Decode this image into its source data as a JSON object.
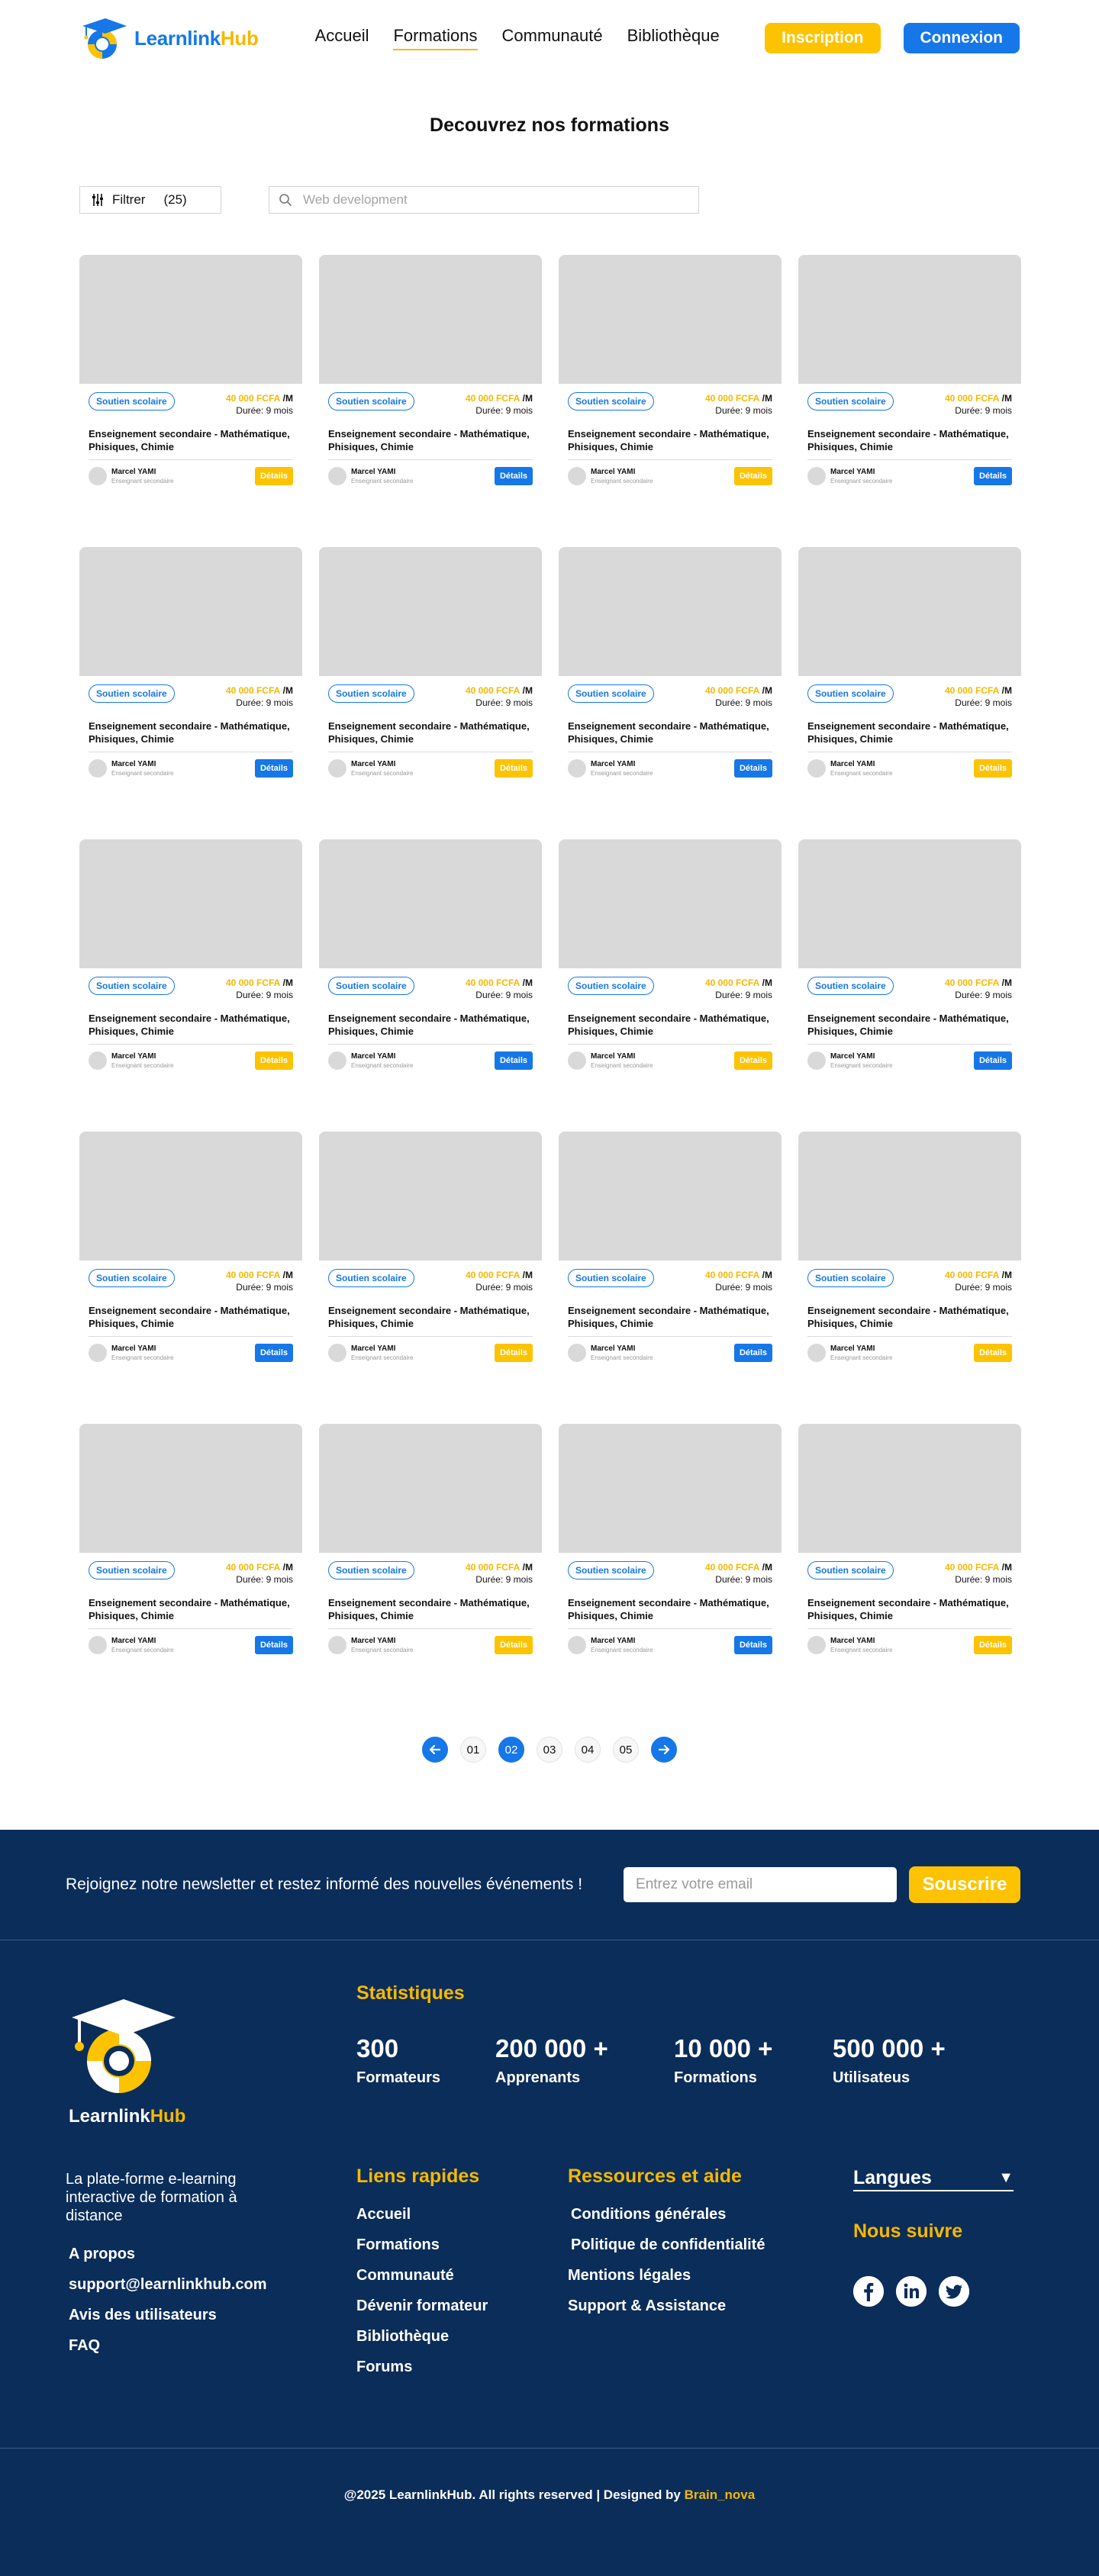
{
  "brand": {
    "name_part1": "Learnlink",
    "name_part2": "Hub"
  },
  "nav": {
    "items": [
      "Accueil",
      "Formations",
      "Communauté",
      "Bibliothèque"
    ],
    "active": "Formations"
  },
  "header": {
    "signup_label": "Inscription",
    "login_label": "Connexion"
  },
  "page": {
    "title": "Decouvrez nos formations"
  },
  "filter": {
    "label": "Filtrer",
    "count": "(25)"
  },
  "search": {
    "placeholder": "Web development"
  },
  "course_template": {
    "tag": "Soutien scolaire",
    "price": "40 000 FCFA",
    "per": "/M",
    "duration": "Durée: 9 mois",
    "title": "Enseignement secondaire - Mathématique, Phisiques, Chimie",
    "author": "Marcel YAMI",
    "author_role": "Enseignant secondaire",
    "details_label": "Détails"
  },
  "courses": [
    {
      "details_color": "yellow"
    },
    {
      "details_color": "blue"
    },
    {
      "details_color": "yellow"
    },
    {
      "details_color": "blue"
    },
    {
      "details_color": "blue"
    },
    {
      "details_color": "yellow"
    },
    {
      "details_color": "blue"
    },
    {
      "details_color": "yellow"
    },
    {
      "details_color": "yellow"
    },
    {
      "details_color": "blue"
    },
    {
      "details_color": "yellow"
    },
    {
      "details_color": "blue"
    },
    {
      "details_color": "blue"
    },
    {
      "details_color": "yellow"
    },
    {
      "details_color": "blue"
    },
    {
      "details_color": "yellow"
    },
    {
      "details_color": "blue"
    },
    {
      "details_color": "yellow"
    },
    {
      "details_color": "blue"
    },
    {
      "details_color": "yellow"
    }
  ],
  "pagination": {
    "pages": [
      "01",
      "02",
      "03",
      "04",
      "05"
    ],
    "current": "02"
  },
  "newsletter": {
    "text": "Rejoignez notre newsletter et restez informé des nouvelles événements !",
    "placeholder": "Entrez votre email",
    "button": "Souscrire"
  },
  "stats": {
    "title": "Statistiques",
    "items": [
      {
        "value": "300",
        "label": "Formateurs"
      },
      {
        "value": "200 000 +",
        "label": "Apprenants"
      },
      {
        "value": "10 000 +",
        "label": "Formations"
      },
      {
        "value": "500 000 +",
        "label": "Utilisateus"
      }
    ]
  },
  "footer": {
    "description": "La plate-forme e-learning interactive de formation à distance",
    "left_links": [
      "A propos",
      "support@learnlinkhub.com",
      "Avis des utilisateurs",
      "FAQ"
    ],
    "quick_links": {
      "title": "Liens rapides",
      "items": [
        "Accueil",
        "Formations",
        "Communauté",
        "Dévenir formateur",
        "Bibliothèque",
        "Forums"
      ]
    },
    "resources": {
      "title": "Ressources et aide",
      "items": [
        "Conditions générales",
        "Politique de confidentialité",
        "Mentions légales",
        "Support & Assistance"
      ]
    },
    "language_label": "Langues",
    "follow_title": "Nous suivre",
    "socials": [
      "facebook-icon",
      "linkedin-icon",
      "twitter-icon"
    ],
    "copyright": "@2025 LearnlinkHub. All rights reserved | Designed by",
    "designer": "Brain_nova"
  },
  "colors": {
    "blue": "#1677e8",
    "yellow": "#fdc300",
    "footer_bg": "#0b2d5a",
    "thumb_gray": "#d9d9d9"
  }
}
